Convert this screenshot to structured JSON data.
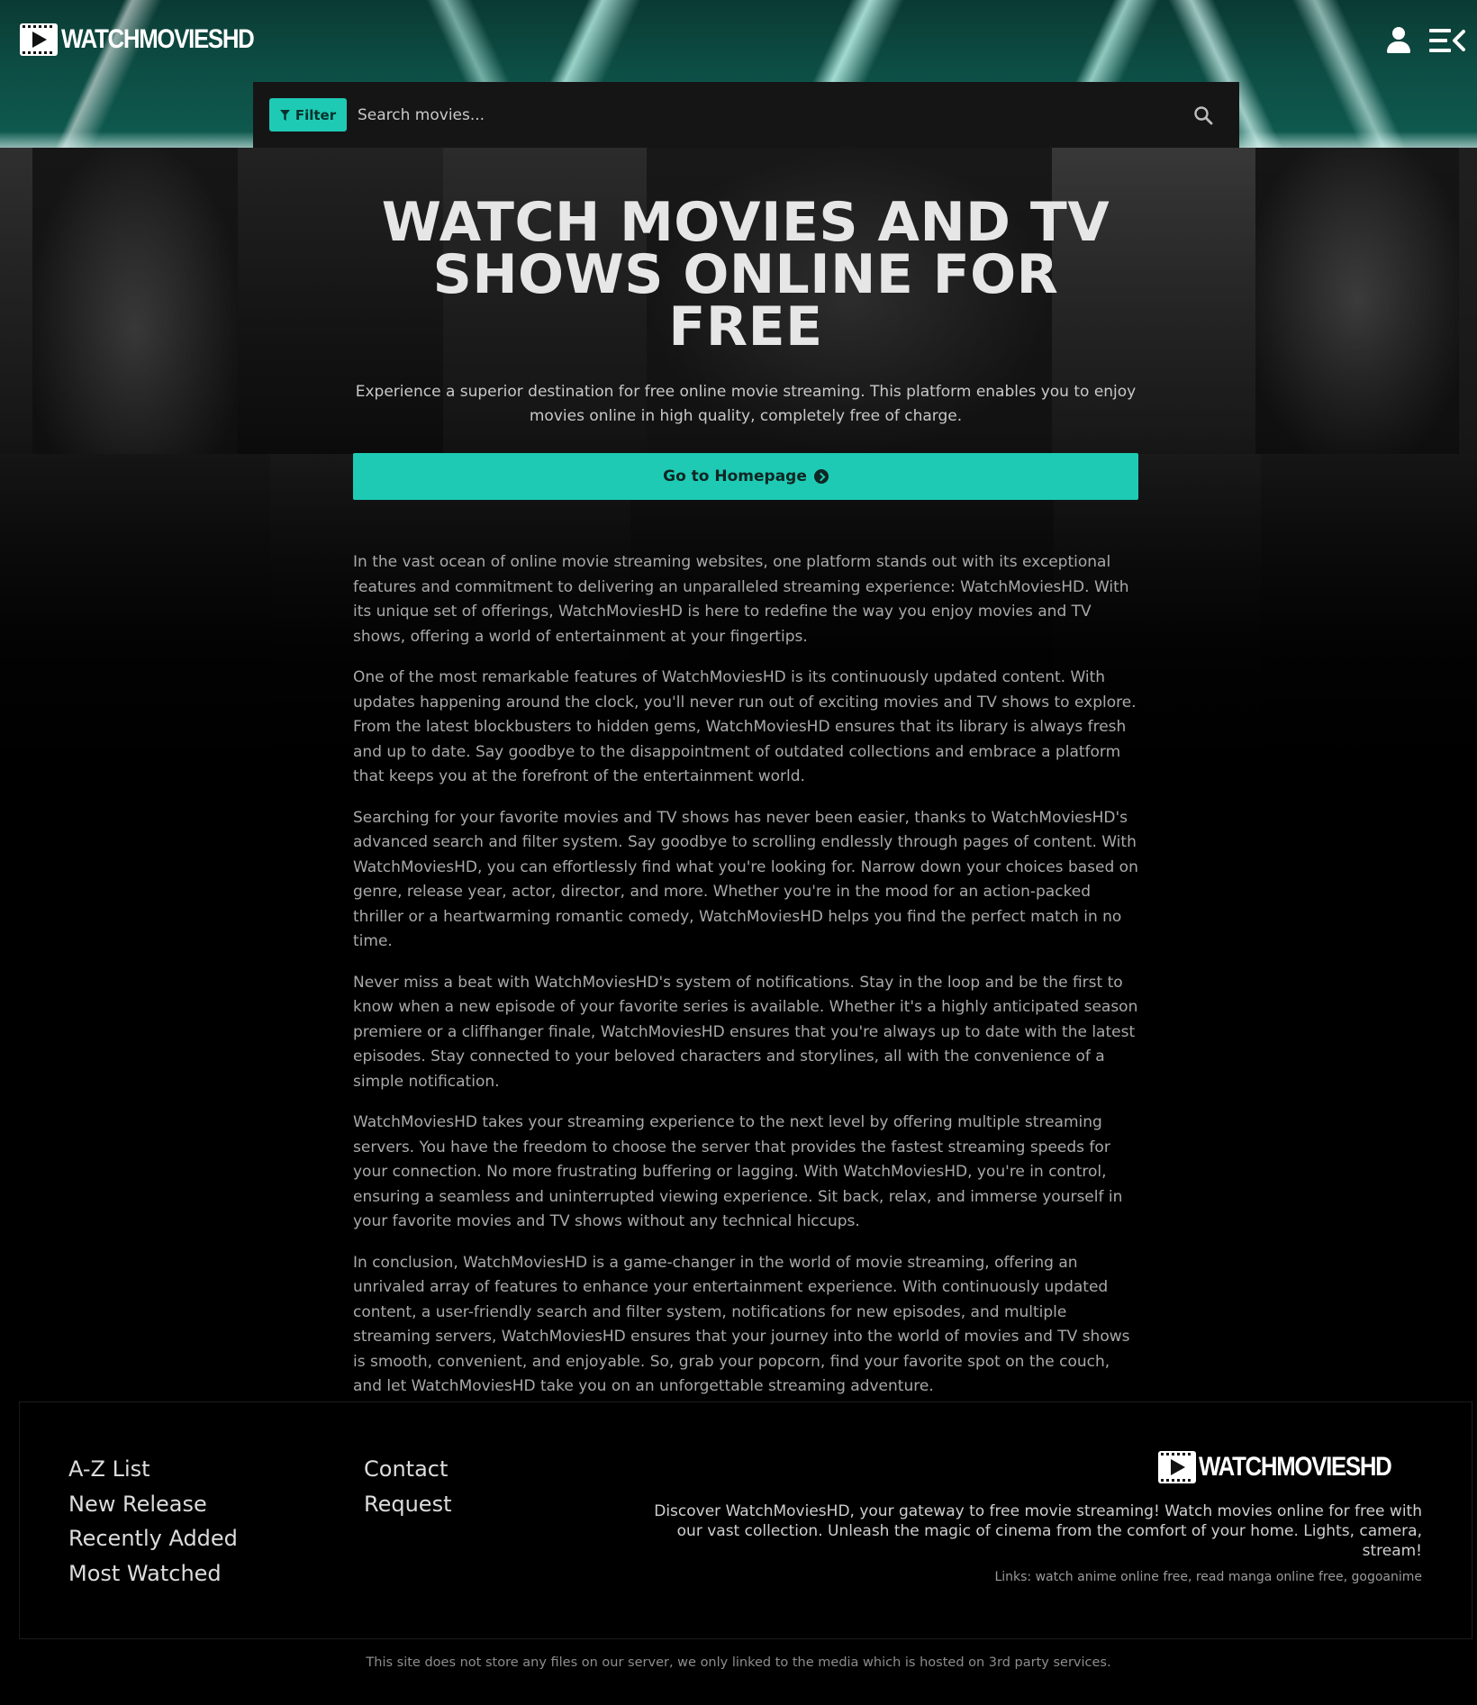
{
  "header": {
    "logo_text": "WATCHMOVIESHD",
    "filter_label": "Filter",
    "search_placeholder": "Search movies...",
    "icons": [
      "user-icon",
      "menu-icon",
      "search-icon",
      "filter-icon"
    ],
    "accent_color": "#1ecab4"
  },
  "hero": {
    "title": "WATCH MOVIES AND TV SHOWS ONLINE FOR FREE",
    "subtitle": "Experience a superior destination for free online movie streaming. This platform enables you to enjoy movies online in high quality, completely free of charge.",
    "button_label": "Go to Homepage"
  },
  "article": {
    "paragraphs": [
      "In the vast ocean of online movie streaming websites, one platform stands out with its exceptional features and commitment to delivering an unparalleled streaming experience: WatchMoviesHD. With its unique set of offerings, WatchMoviesHD is here to redefine the way you enjoy movies and TV shows, offering a world of entertainment at your fingertips.",
      "One of the most remarkable features of WatchMoviesHD is its continuously updated content. With updates happening around the clock, you'll never run out of exciting movies and TV shows to explore. From the latest blockbusters to hidden gems, WatchMoviesHD ensures that its library is always fresh and up to date. Say goodbye to the disappointment of outdated collections and embrace a platform that keeps you at the forefront of the entertainment world.",
      "Searching for your favorite movies and TV shows has never been easier, thanks to WatchMoviesHD's advanced search and filter system. Say goodbye to scrolling endlessly through pages of content. With WatchMoviesHD, you can effortlessly find what you're looking for. Narrow down your choices based on genre, release year, actor, director, and more. Whether you're in the mood for an action-packed thriller or a heartwarming romantic comedy, WatchMoviesHD helps you find the perfect match in no time.",
      "Never miss a beat with WatchMoviesHD's system of notifications. Stay in the loop and be the first to know when a new episode of your favorite series is available. Whether it's a highly anticipated season premiere or a cliffhanger finale, WatchMoviesHD ensures that you're always up to date with the latest episodes. Stay connected to your beloved characters and storylines, all with the convenience of a simple notification.",
      "WatchMoviesHD takes your streaming experience to the next level by offering multiple streaming servers. You have the freedom to choose the server that provides the fastest streaming speeds for your connection. No more frustrating buffering or lagging. With WatchMoviesHD, you're in control, ensuring a seamless and uninterrupted viewing experience. Sit back, relax, and immerse yourself in your favorite movies and TV shows without any technical hiccups.",
      "In conclusion, WatchMoviesHD is a game-changer in the world of movie streaming, offering an unrivaled array of features to enhance your entertainment experience. With continuously updated content, a user-friendly search and filter system, notifications for new episodes, and multiple streaming servers, WatchMoviesHD ensures that your journey into the world of movies and TV shows is smooth, convenient, and enjoyable. So, grab your popcorn, find your favorite spot on the couch, and let WatchMoviesHD take you on an unforgettable streaming adventure."
    ]
  },
  "footer": {
    "col1": [
      "A-Z List",
      "New Release",
      "Recently Added",
      "Most Watched"
    ],
    "col2": [
      "Contact",
      "Request"
    ],
    "logo_text": "WATCHMOVIESHD",
    "description": "Discover WatchMoviesHD, your gateway to free movie streaming! Watch movies online for free with our vast collection. Unleash the magic of cinema from the comfort of your home. Lights, camera, stream!",
    "links_label": "Links:",
    "links": [
      "watch anime online free",
      "read manga online free",
      "gogoanime"
    ],
    "disclaimer": "This site does not store any files on our server, we only linked to the media which is hosted on 3rd party services."
  }
}
